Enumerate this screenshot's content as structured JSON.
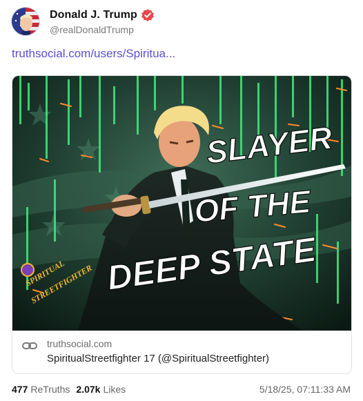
{
  "post": {
    "author_name": "Donald J. Trump",
    "author_handle": "@realDonaldTrump",
    "link_text": "truthsocial.com/users/Spiritua...",
    "card": {
      "domain": "truthsocial.com",
      "title": "SpiritualStreetfighter 17 (@SpiritualStreetfighter)",
      "image": {
        "headline_line1": "SLAYER",
        "headline_line2": "OF THE",
        "headline_line3": "DEEP STATE",
        "watermark_line1": "SPIRITUAL",
        "watermark_line2": "STREETFIGHTER"
      }
    },
    "stats": {
      "retruths_count": "477",
      "retruths_label": "ReTruths",
      "likes_count": "2.07k",
      "likes_label": "Likes",
      "timestamp": "5/18/25, 07:11:33 AM"
    }
  },
  "colors": {
    "link": "#5b4fd6",
    "verified_badge": "#e8474d",
    "matrix_green": "#3cf07a"
  },
  "icons": {
    "verified": "verified-badge-icon",
    "link": "link-chain-icon"
  }
}
